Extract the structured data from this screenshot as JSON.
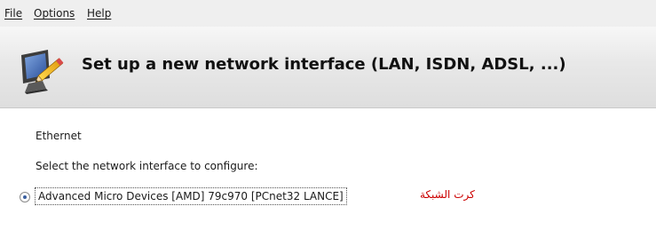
{
  "menubar": {
    "items": [
      {
        "label": "File"
      },
      {
        "label": "Options"
      },
      {
        "label": "Help"
      }
    ]
  },
  "header": {
    "title": "Set up a new network interface (LAN, ISDN, ADSL, ...)",
    "icon": "monitor-pencil-icon"
  },
  "content": {
    "section_label": "Ethernet",
    "prompt": "Select the network interface to configure:",
    "options": [
      {
        "label": "Advanced Micro Devices [AMD] 79c970 [PCnet32 LANCE]",
        "selected": true
      }
    ],
    "annotation": "كرت الشبكة"
  },
  "colors": {
    "annotation": "#cc0000",
    "radio_selected": "#3a5f9f",
    "header_bg": "#e8e8e8",
    "menubar_bg": "#efefef"
  }
}
